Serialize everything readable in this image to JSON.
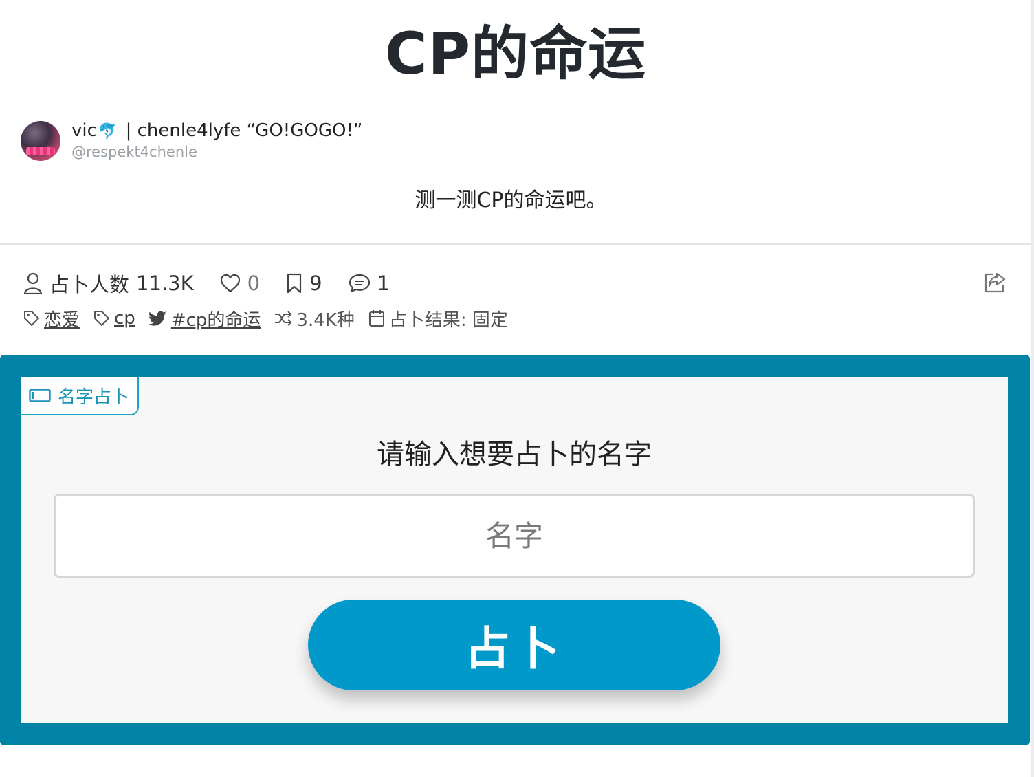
{
  "page": {
    "title": "CP的命运",
    "description": "测一测CP的命运吧。"
  },
  "author": {
    "name_prefix": "vic",
    "name_emoji": "🐬",
    "name_suffix": " | chenle4lyfe “GO!GOGO!”",
    "handle": "@respekt4chenle"
  },
  "stats": {
    "players_label": "占卜人数",
    "players_count": "11.3K",
    "likes": "0",
    "bookmarks": "9",
    "comments": "1"
  },
  "tags": {
    "tag1": "恋爱",
    "tag2": "cp",
    "hashtag": "#cp的命运",
    "variations": "3.4K种",
    "result_type": "占卜结果: 固定"
  },
  "divination": {
    "badge_label": "名字占卜",
    "prompt": "请输入想要占卜的名字",
    "input_value": "",
    "input_placeholder": "名字",
    "button_label": "占卜"
  },
  "colors": {
    "panel_border": "#0083a6",
    "button": "#0198ca",
    "badge_accent": "#1aa3cc"
  },
  "icons": [
    "person-icon",
    "heart-icon",
    "bookmark-icon",
    "comment-icon",
    "share-icon",
    "tag-icon",
    "twitter-icon",
    "shuffle-icon",
    "calendar-icon",
    "card-icon",
    "dolphin-emoji"
  ]
}
